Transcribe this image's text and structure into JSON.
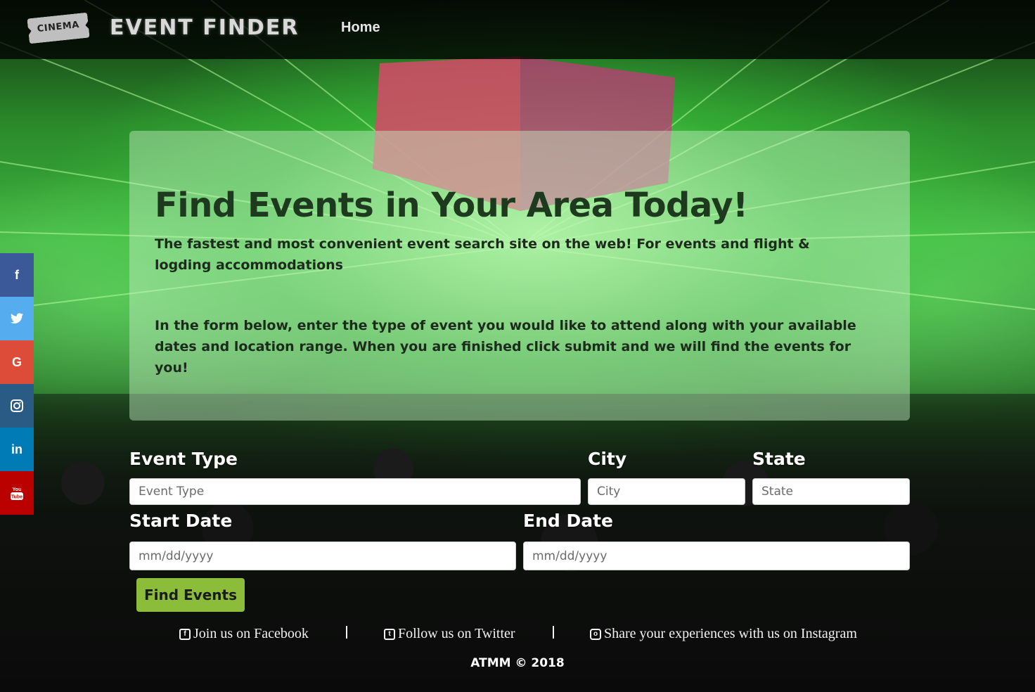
{
  "colors": {
    "navbar": "#000000",
    "facebook": "#3b5998",
    "twitter": "#55acee",
    "google": "#dd4b39",
    "instagram": "#2a5b84",
    "linkedin": "#007bb5",
    "youtube": "#bb0000",
    "submit": "#8bbd3b"
  },
  "navbar": {
    "logo_text": "CINEMA",
    "brand": "EVENT FINDER",
    "home_label": "Home"
  },
  "social": [
    {
      "icon": "facebook-icon",
      "glyph": "f"
    },
    {
      "icon": "twitter-icon",
      "glyph": "t"
    },
    {
      "icon": "google-icon",
      "glyph": "G"
    },
    {
      "icon": "instagram-icon",
      "glyph": "◎"
    },
    {
      "icon": "linkedin-icon",
      "glyph": "in"
    },
    {
      "icon": "youtube-icon",
      "glyph": "You Tube"
    }
  ],
  "hero": {
    "title": "Find Events in Your Area Today!",
    "lead": "The fastest and most convenient event search site on the web! For events and flight & logding accommodations",
    "body": "In the form below, enter the type of event you would like to attend along with your available dates and location range. When you are finished click submit and we will find the events for you!"
  },
  "form": {
    "event_type": {
      "label": "Event Type",
      "placeholder": "Event Type"
    },
    "city": {
      "label": "City",
      "placeholder": "City"
    },
    "state": {
      "label": "State",
      "placeholder": "State"
    },
    "start_date": {
      "label": "Start Date",
      "placeholder": "mm/dd/yyyy"
    },
    "end_date": {
      "label": "End Date",
      "placeholder": "mm/dd/yyyy"
    },
    "submit_label": "Find Events"
  },
  "footer": {
    "facebook": "Join us on Facebook",
    "twitter": "Follow us on Twitter",
    "instagram": "Share your experiences with us on Instagram",
    "copyright": "ATMM © 2018"
  }
}
